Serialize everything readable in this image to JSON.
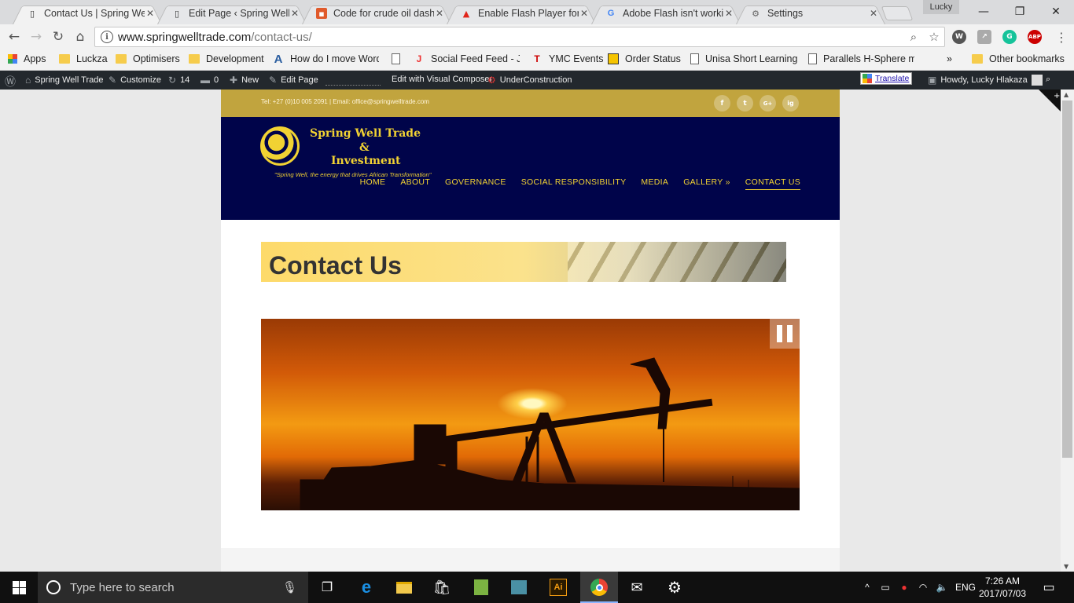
{
  "browser": {
    "tabs": [
      {
        "title": "Contact Us | Spring Well Trade & Investment",
        "icon": "page-icon",
        "active": true
      },
      {
        "title": "Edit Page ‹ Spring Well Trade",
        "icon": "page-icon",
        "active": false
      },
      {
        "title": "Code for crude oil dashboard",
        "icon": "code-icon",
        "active": false
      },
      {
        "title": "Enable Flash Player for Chrome",
        "icon": "adobe-icon",
        "active": false
      },
      {
        "title": "Adobe Flash isn't working",
        "icon": "google-icon",
        "active": false
      },
      {
        "title": "Settings",
        "icon": "gear-icon",
        "active": false
      }
    ],
    "profile_name": "Lucky",
    "url_domain": "www.springwelltrade.com",
    "url_path": "/contact-us/",
    "bookmarks": [
      {
        "label": "Apps",
        "icon": "apps-grid-icon"
      },
      {
        "label": "Luckza",
        "icon": "folder-icon"
      },
      {
        "label": "Optimisers",
        "icon": "folder-icon"
      },
      {
        "label": "Development",
        "icon": "folder-icon"
      },
      {
        "label": "How do I move Word",
        "icon": "a-logo-icon"
      },
      {
        "label": "",
        "icon": "page-icon"
      },
      {
        "label": "Social Feed Feed - Ju",
        "icon": "j-logo-icon"
      },
      {
        "label": "YMC Events",
        "icon": "t-logo-icon"
      },
      {
        "label": "Order Status",
        "icon": "order-icon"
      },
      {
        "label": "Unisa Short Learning",
        "icon": "page-icon"
      },
      {
        "label": "Parallels H-Sphere m",
        "icon": "page-icon"
      }
    ],
    "bookmarks_overflow": "»",
    "other_bookmarks": "Other bookmarks"
  },
  "wp_admin": {
    "site_name": "Spring Well Trade",
    "customize": "Customize",
    "updates_count": "14",
    "comments_count": "0",
    "new_label": "New",
    "edit_page": "Edit Page",
    "visual_composer": "Edit with Visual Composer",
    "under_construction": "UnderConstruction",
    "translate": "Translate",
    "howdy": "Howdy, Lucky Hlakaza"
  },
  "site": {
    "contact_line": "Tel: +27 (0)10 005 2091 | Email: office@springwelltrade.com",
    "social": [
      "f",
      "t",
      "G+",
      "ig"
    ],
    "logo_line1": "Spring Well Trade",
    "logo_line2": "&",
    "logo_line3": "Investment",
    "tagline": "\"Spring Well, the energy that drives African Transformation\"",
    "nav": [
      {
        "label": "HOME",
        "active": false
      },
      {
        "label": "ABOUT",
        "active": false
      },
      {
        "label": "GOVERNANCE",
        "active": false
      },
      {
        "label": "SOCIAL RESPONSIBILITY",
        "active": false
      },
      {
        "label": "MEDIA",
        "active": false
      },
      {
        "label": "GALLERY »",
        "active": false
      },
      {
        "label": "CONTACT US",
        "active": true
      }
    ],
    "banner_title": "Contact Us"
  },
  "taskbar": {
    "search_placeholder": "Type here to search",
    "lang": "ENG",
    "time": "7:26 AM",
    "date": "2017/07/03"
  },
  "colors": {
    "gold": "#c1a43e",
    "navy": "#00044a",
    "nav_text": "#f1d233"
  }
}
